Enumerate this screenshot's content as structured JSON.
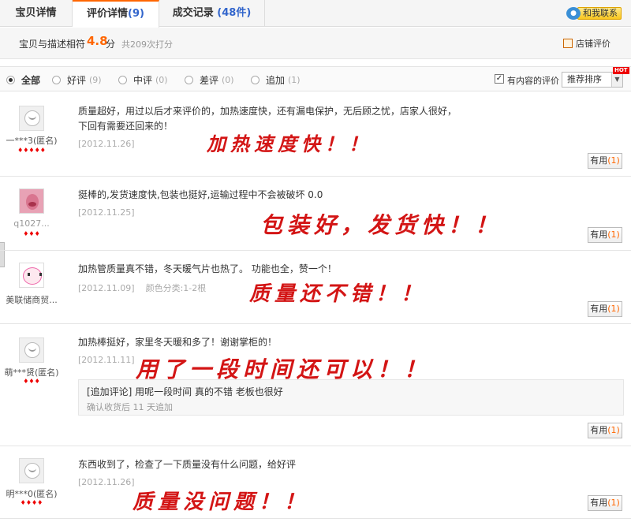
{
  "tabs": [
    {
      "label": "宝贝详情",
      "count": ""
    },
    {
      "label": "评价详情",
      "count": "(9)"
    },
    {
      "label": "成交记录",
      "count": "(48件)"
    }
  ],
  "contact": {
    "label": "和我联系",
    "icon": "chat-bubble-icon"
  },
  "score": {
    "text": "宝贝与描述相符",
    "value": "4.8",
    "unit": "分",
    "count": "共209次打分",
    "shop_label": "店铺评价"
  },
  "filters": [
    {
      "label": "全部",
      "count": ""
    },
    {
      "label": "好评",
      "count": "(9)"
    },
    {
      "label": "中评",
      "count": "(0)"
    },
    {
      "label": "差评",
      "count": "(0)"
    },
    {
      "label": "追加",
      "count": "(1)"
    }
  ],
  "content_filter": {
    "label": "有内容的评价",
    "checked": true
  },
  "sort": {
    "value": "推荐排序",
    "hot": "HOT"
  },
  "reviews": [
    {
      "user": "一***3(匿名)",
      "hearts": "♦♦♦♦♦",
      "text1": "质量超好，用过以后才来评价的，加热速度快，还有漏电保护，无后顾之忧，店家人很好，",
      "text2": "下回有需要还回来的！",
      "date": "[2012.11.26]",
      "handwriting": "加热速度快！！",
      "useful": "有用",
      "useful_count": "(1)"
    },
    {
      "user": "q1027...",
      "hearts": "♦♦♦",
      "text1": "挺棒的,发货速度快,包装也挺好,运输过程中不会被破坏 0.0",
      "date": "[2012.11.25]",
      "handwriting": "包装好，发货快！！",
      "useful": "有用",
      "useful_count": "(1)"
    },
    {
      "user": "美联储商贸...",
      "hearts": "",
      "text1": "加热管质量真不错，冬天暖气片也热了。 功能也全，赞一个！",
      "date": "[2012.11.09]",
      "category": "颜色分类:1-2根",
      "handwriting": "质量还不错！！",
      "useful": "有用",
      "useful_count": "(1)"
    },
    {
      "user": "萌***贤(匿名)",
      "hearts": "♦♦♦",
      "text1": "加热棒挺好，家里冬天暖和多了！谢谢掌柜的！",
      "date": "[2012.11.11]",
      "handwriting": "用了一段时间还可以！！",
      "append_text": "[追加评论] 用呢一段时间 真的不错 老板也很好",
      "append_meta": "确认收货后 11 天追加",
      "useful": "有用",
      "useful_count": "(1)"
    },
    {
      "user": "明***0(匿名)",
      "hearts": "♦♦♦♦",
      "text1": "东西收到了，检查了一下质量没有什么问题，给好评",
      "date": "[2012.11.26]",
      "handwriting": "质量没问题！！",
      "useful": "有用",
      "useful_count": "(1)"
    }
  ]
}
